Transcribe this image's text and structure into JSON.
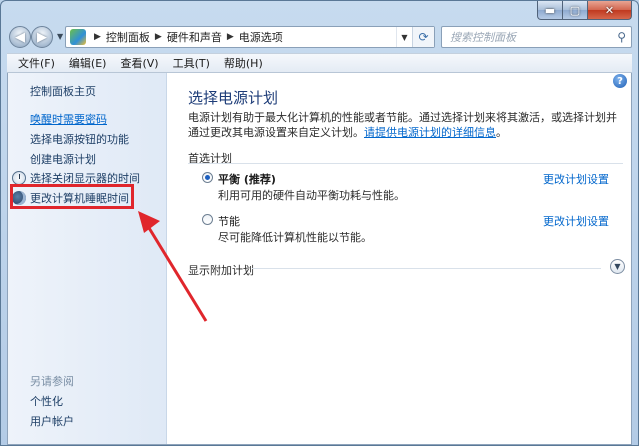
{
  "window": {
    "caption": {
      "minimize": "▬",
      "maximize": "▢",
      "close": "✕"
    }
  },
  "address": {
    "crumbs": [
      "控制面板",
      "硬件和声音",
      "电源选项"
    ],
    "search_placeholder": "搜索控制面板"
  },
  "menu": [
    "文件(F)",
    "编辑(E)",
    "查看(V)",
    "工具(T)",
    "帮助(H)"
  ],
  "sidebar": {
    "home": "控制面板主页",
    "links": [
      "唤醒时需要密码",
      "选择电源按钮的功能",
      "创建电源计划"
    ],
    "icon_links": [
      {
        "label": "选择关闭显示器的时间",
        "icon": "clock-icon"
      },
      {
        "label": "更改计算机睡眠时间",
        "icon": "moon-icon"
      }
    ],
    "see_also_header": "另请参阅",
    "see_also": [
      "个性化",
      "用户帐户"
    ]
  },
  "main": {
    "title": "选择电源计划",
    "desc_text": "电源计划有助于最大化计算机的性能或者节能。通过选择计划来将其激活，或选择计划并通过更改其电源设置来自定义计划。",
    "desc_link": "请提供电源计划的详细信息",
    "desc_tail": "。",
    "group_header": "首选计划",
    "plans": [
      {
        "name": "平衡 (推荐)",
        "desc": "利用可用的硬件自动平衡功耗与性能。",
        "link": "更改计划设置",
        "selected": true
      },
      {
        "name": "节能",
        "desc": "尽可能降低计算机性能以节能。",
        "link": "更改计划设置",
        "selected": false
      }
    ],
    "extra_plans": "显示附加计划"
  },
  "colors": {
    "highlight": "#e0262c",
    "link": "#0066cc",
    "title": "#1d3c78"
  }
}
